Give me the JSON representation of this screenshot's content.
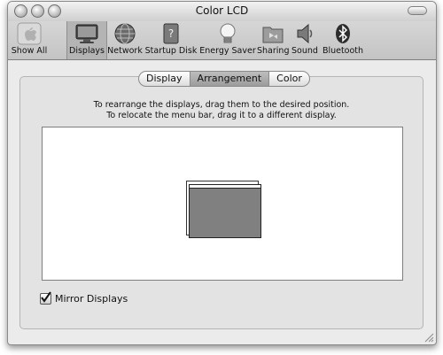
{
  "window": {
    "title": "Color LCD"
  },
  "toolbar": {
    "items": [
      {
        "label": "Show All",
        "icon": "apple-icon"
      },
      {
        "label": "Displays",
        "icon": "monitor-icon",
        "selected": true
      },
      {
        "label": "Network",
        "icon": "globe-icon"
      },
      {
        "label": "Startup Disk",
        "icon": "hard-disk-icon"
      },
      {
        "label": "Energy Saver",
        "icon": "lightbulb-icon"
      },
      {
        "label": "Sharing",
        "icon": "folder-icon"
      },
      {
        "label": "Sound",
        "icon": "speaker-icon"
      },
      {
        "label": "Bluetooth",
        "icon": "bluetooth-icon"
      }
    ]
  },
  "tabs": {
    "items": [
      {
        "label": "Display"
      },
      {
        "label": "Arrangement",
        "active": true
      },
      {
        "label": "Color"
      }
    ]
  },
  "arrangement": {
    "instruction_line1": "To rearrange the displays, drag them to the desired position.",
    "instruction_line2": "To relocate the menu bar, drag it to a different display.",
    "mirror_label": "Mirror Displays",
    "mirror_checked": true
  }
}
